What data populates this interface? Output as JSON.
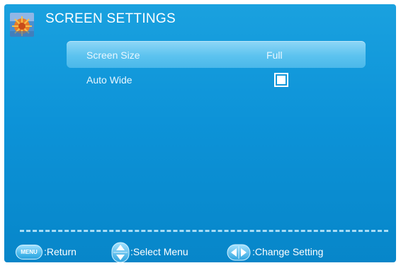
{
  "header": {
    "title": "SCREEN SETTINGS"
  },
  "menu": {
    "items": [
      {
        "label": "Screen Size",
        "value": "Full",
        "selected": true
      },
      {
        "label": "Auto Wide",
        "control": "checkbox",
        "checked": true
      }
    ]
  },
  "footer": {
    "menu_key_label": "MENU",
    "return_label": ":Return",
    "select_label": ":Select Menu",
    "change_label": ":Change Setting"
  },
  "colors": {
    "background": "#0d93d8",
    "highlight": "#5cc3ef",
    "text": "#ffffff"
  }
}
